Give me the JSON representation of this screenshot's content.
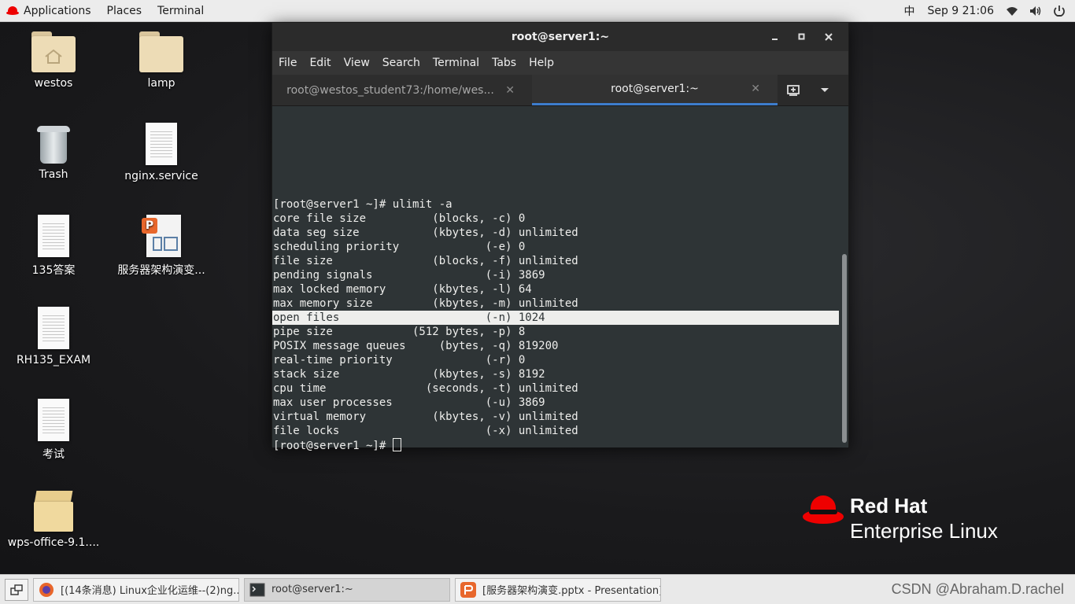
{
  "topbar": {
    "applications": "Applications",
    "places": "Places",
    "terminal": "Terminal",
    "input_method": "中",
    "datetime": "Sep 9  21:06"
  },
  "desktop": {
    "icons": [
      {
        "label": "westos",
        "icon": "home-folder-icon"
      },
      {
        "label": "lamp",
        "icon": "folder-icon"
      },
      {
        "label": "Trash",
        "icon": "trash-icon"
      },
      {
        "label": "nginx.service",
        "icon": "text-file-icon"
      },
      {
        "label": "135答案",
        "icon": "text-file-icon"
      },
      {
        "label": "服务器架构演变...",
        "icon": "presentation-file-icon"
      },
      {
        "label": "RH135_EXAM",
        "icon": "text-file-icon"
      },
      {
        "label": "考试",
        "icon": "text-file-icon"
      },
      {
        "label": "wps-office-9.1....",
        "icon": "package-icon"
      }
    ]
  },
  "terminal": {
    "title": "root@server1:~",
    "menu": [
      "File",
      "Edit",
      "View",
      "Search",
      "Terminal",
      "Tabs",
      "Help"
    ],
    "tabs": [
      {
        "label": "root@westos_student73:/home/wes..."
      },
      {
        "label": "root@server1:~"
      }
    ],
    "lines": [
      "[root@server1 ~]# ulimit -a",
      "core file size          (blocks, -c) 0",
      "data seg size           (kbytes, -d) unlimited",
      "scheduling priority             (-e) 0",
      "file size               (blocks, -f) unlimited",
      "pending signals                 (-i) 3869",
      "max locked memory       (kbytes, -l) 64",
      "max memory size         (kbytes, -m) unlimited",
      "open files                      (-n) 1024",
      "pipe size            (512 bytes, -p) 8",
      "POSIX message queues     (bytes, -q) 819200",
      "real-time priority              (-r) 0",
      "stack size              (kbytes, -s) 8192",
      "cpu time               (seconds, -t) unlimited",
      "max user processes              (-u) 3869",
      "virtual memory          (kbytes, -v) unlimited",
      "file locks                      (-x) unlimited",
      "[root@server1 ~]# "
    ]
  },
  "brand": {
    "line1": "Red Hat",
    "line2": "Enterprise Linux"
  },
  "taskbar": {
    "tasks": [
      {
        "label": "[(14条消息) Linux企业化运维--(2)ng..."
      },
      {
        "label": "root@server1:~"
      },
      {
        "label": "[服务器架构演变.pptx - Presentation]"
      }
    ],
    "watermark": "CSDN @Abraham.D.rachel"
  },
  "colors": {
    "terminal_bg": "#2e3436",
    "terminal_fg": "#eeeeec",
    "tab_accent": "#3d7dcc",
    "redhat_red": "#ee0000"
  }
}
